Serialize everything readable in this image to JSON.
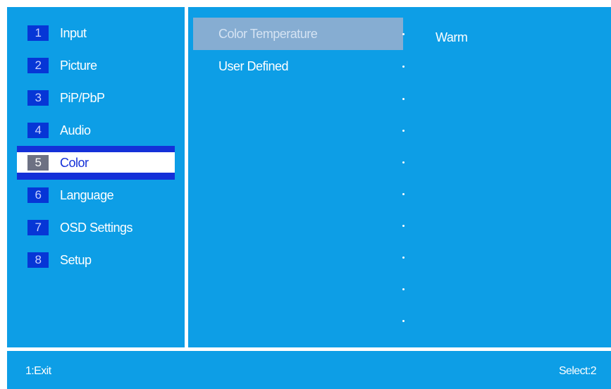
{
  "menu": {
    "items": [
      {
        "num": "1",
        "label": "Input"
      },
      {
        "num": "2",
        "label": "Picture"
      },
      {
        "num": "3",
        "label": "PiP/PbP"
      },
      {
        "num": "4",
        "label": "Audio"
      },
      {
        "num": "5",
        "label": "Color",
        "selected": true
      },
      {
        "num": "6",
        "label": "Language"
      },
      {
        "num": "7",
        "label": "OSD Settings"
      },
      {
        "num": "8",
        "label": "Setup"
      }
    ]
  },
  "submenu": {
    "items": [
      {
        "label": "Color Temperature",
        "highlighted": true
      },
      {
        "label": "User Defined"
      }
    ],
    "selected_value": "Warm"
  },
  "footer": {
    "left": "1:Exit",
    "right": "Select:2"
  },
  "colors": {
    "panel_bg": "#0d9ee6",
    "number_badge": "#0636d6",
    "selection_band": "#1430d8",
    "highlight_row": "#86add2",
    "border": "#ffffff"
  }
}
